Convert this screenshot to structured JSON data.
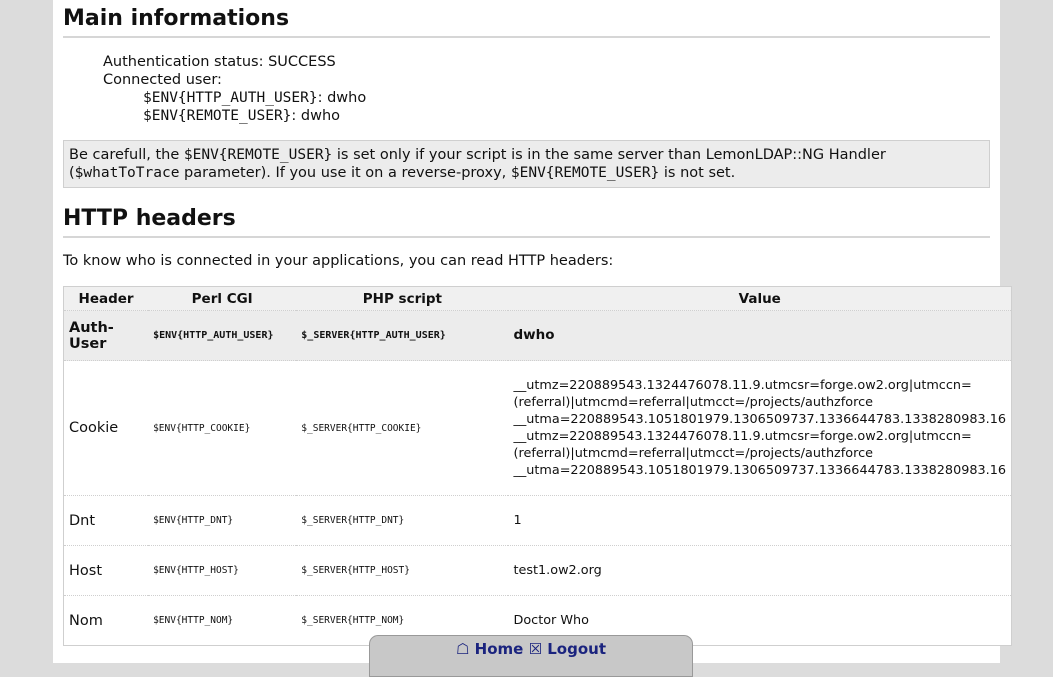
{
  "main": {
    "title": "Main informations",
    "auth_status": "Authentication status: SUCCESS",
    "connected_user": "Connected user:",
    "auth_user_var": "$ENV{HTTP_AUTH_USER}",
    "auth_user_val": ": dwho",
    "remote_user_var": "$ENV{REMOTE_USER}",
    "remote_user_val": ": dwho",
    "note": {
      "p1": "Be carefull, the ",
      "var1": "$ENV{REMOTE_USER}",
      "p2": " is set only if your script is in the same server than LemonLDAP::NG Handler (",
      "var2": "$whatToTrace",
      "p3": " parameter). If you use it on a reverse-proxy, ",
      "var3": "$ENV{REMOTE_USER}",
      "p4": " is not set."
    }
  },
  "headers": {
    "title": "HTTP headers",
    "intro": "To know who is connected in your applications, you can read HTTP headers:",
    "columns": [
      "Header",
      "Perl CGI",
      "PHP script",
      "Value"
    ],
    "rows": [
      {
        "header": "Auth-User",
        "perl": "$ENV{HTTP_AUTH_USER}",
        "php": "$_SERVER{HTTP_AUTH_USER}",
        "value": "dwho"
      },
      {
        "header": "Cookie",
        "perl": "$ENV{HTTP_COOKIE}",
        "php": "$_SERVER{HTTP_COOKIE}",
        "value_lines": [
          "__utmz=220889543.1324476078.11.9.utmcsr=forge.ow2.org|utmccn=",
          "(referral)|utmcmd=referral|utmcct=/projects/authzforce",
          "__utma=220889543.1051801979.1306509737.1336644783.1338280983.16",
          "__utmz=220889543.1324476078.11.9.utmcsr=forge.ow2.org|utmccn=",
          "(referral)|utmcmd=referral|utmcct=/projects/authzforce",
          "__utma=220889543.1051801979.1306509737.1336644783.1338280983.16"
        ]
      },
      {
        "header": "Dnt",
        "perl": "$ENV{HTTP_DNT}",
        "php": "$_SERVER{HTTP_DNT}",
        "value": "1"
      },
      {
        "header": "Host",
        "perl": "$ENV{HTTP_HOST}",
        "php": "$_SERVER{HTTP_HOST}",
        "value": "test1.ow2.org"
      },
      {
        "header": "Nom",
        "perl": "$ENV{HTTP_NOM}",
        "php": "$_SERVER{HTTP_NOM}",
        "value": "Doctor Who"
      }
    ]
  },
  "dock": {
    "home_icon": "home-icon",
    "home_glyph": "☖",
    "home_label": "Home",
    "logout_icon": "logout-icon",
    "logout_glyph": "☒",
    "logout_label": "Logout"
  }
}
